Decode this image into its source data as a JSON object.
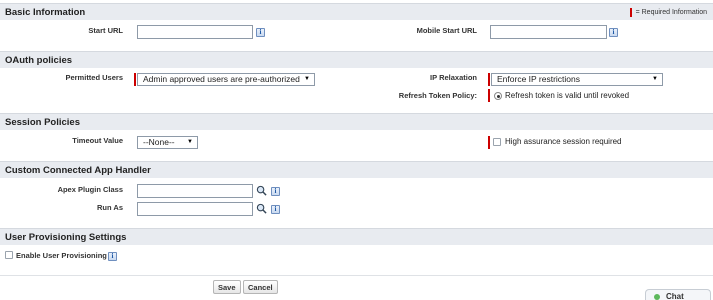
{
  "basic_info": {
    "title": "Basic Information",
    "required_legend": "= Required Information",
    "start_url_label": "Start URL",
    "start_url_value": "",
    "mobile_start_url_label": "Mobile Start URL",
    "mobile_start_url_value": ""
  },
  "oauth": {
    "title": "OAuth policies",
    "permitted_users_label": "Permitted Users",
    "permitted_users_value": "Admin approved users are pre-authorized",
    "ip_relaxation_label": "IP Relaxation",
    "ip_relaxation_value": "Enforce IP restrictions",
    "refresh_token_label": "Refresh Token Policy:",
    "refresh_token_value": "Refresh token is valid until revoked"
  },
  "session": {
    "title": "Session Policies",
    "timeout_label": "Timeout Value",
    "timeout_value": "--None--",
    "high_assurance_label": "High assurance session required"
  },
  "handler": {
    "title": "Custom Connected App Handler",
    "apex_plugin_label": "Apex Plugin Class",
    "apex_plugin_value": "",
    "run_as_label": "Run As",
    "run_as_value": ""
  },
  "provisioning": {
    "title": "User Provisioning Settings",
    "enable_label": "Enable User Provisioning"
  },
  "buttons": {
    "save": "Save",
    "cancel": "Cancel"
  },
  "chat": {
    "label": "Chat"
  },
  "colors": {
    "required": "#cc0000",
    "section_header_bg": "#e8ebf0"
  }
}
